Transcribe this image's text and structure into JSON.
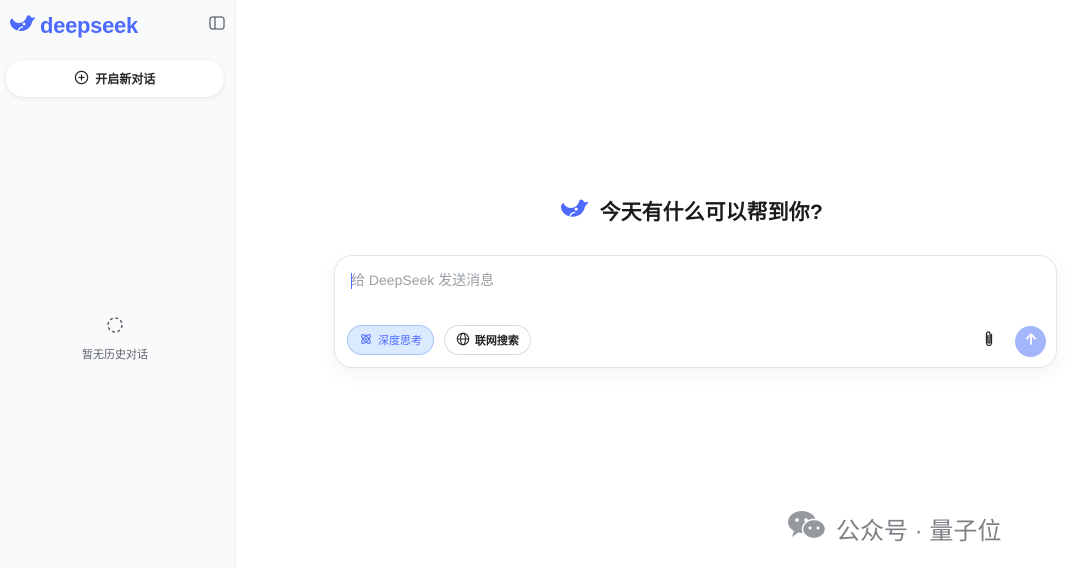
{
  "sidebar": {
    "logo_text": "deepseek",
    "new_chat_label": "开启新对话",
    "empty_history_label": "暂无历史对话"
  },
  "main": {
    "greeting": "今天有什么可以帮到你?",
    "composer": {
      "placeholder": "给 DeepSeek 发送消息",
      "deep_think_label": "深度思考",
      "web_search_label": "联网搜索"
    }
  },
  "watermark": {
    "text": "公众号 · 量子位"
  },
  "colors": {
    "brand": "#4d6bfe",
    "send_disabled": "#a3b6fb",
    "deep_think_bg": "#dbeafe"
  },
  "icons": {
    "logo": "whale-icon",
    "collapse": "sidebar-toggle-icon",
    "new_chat": "plus-circle-icon",
    "empty": "loading-icon",
    "deep_think": "atom-icon",
    "web_search": "globe-icon",
    "attach": "paperclip-icon",
    "send": "arrow-up-icon",
    "watermark": "wechat-icon"
  }
}
